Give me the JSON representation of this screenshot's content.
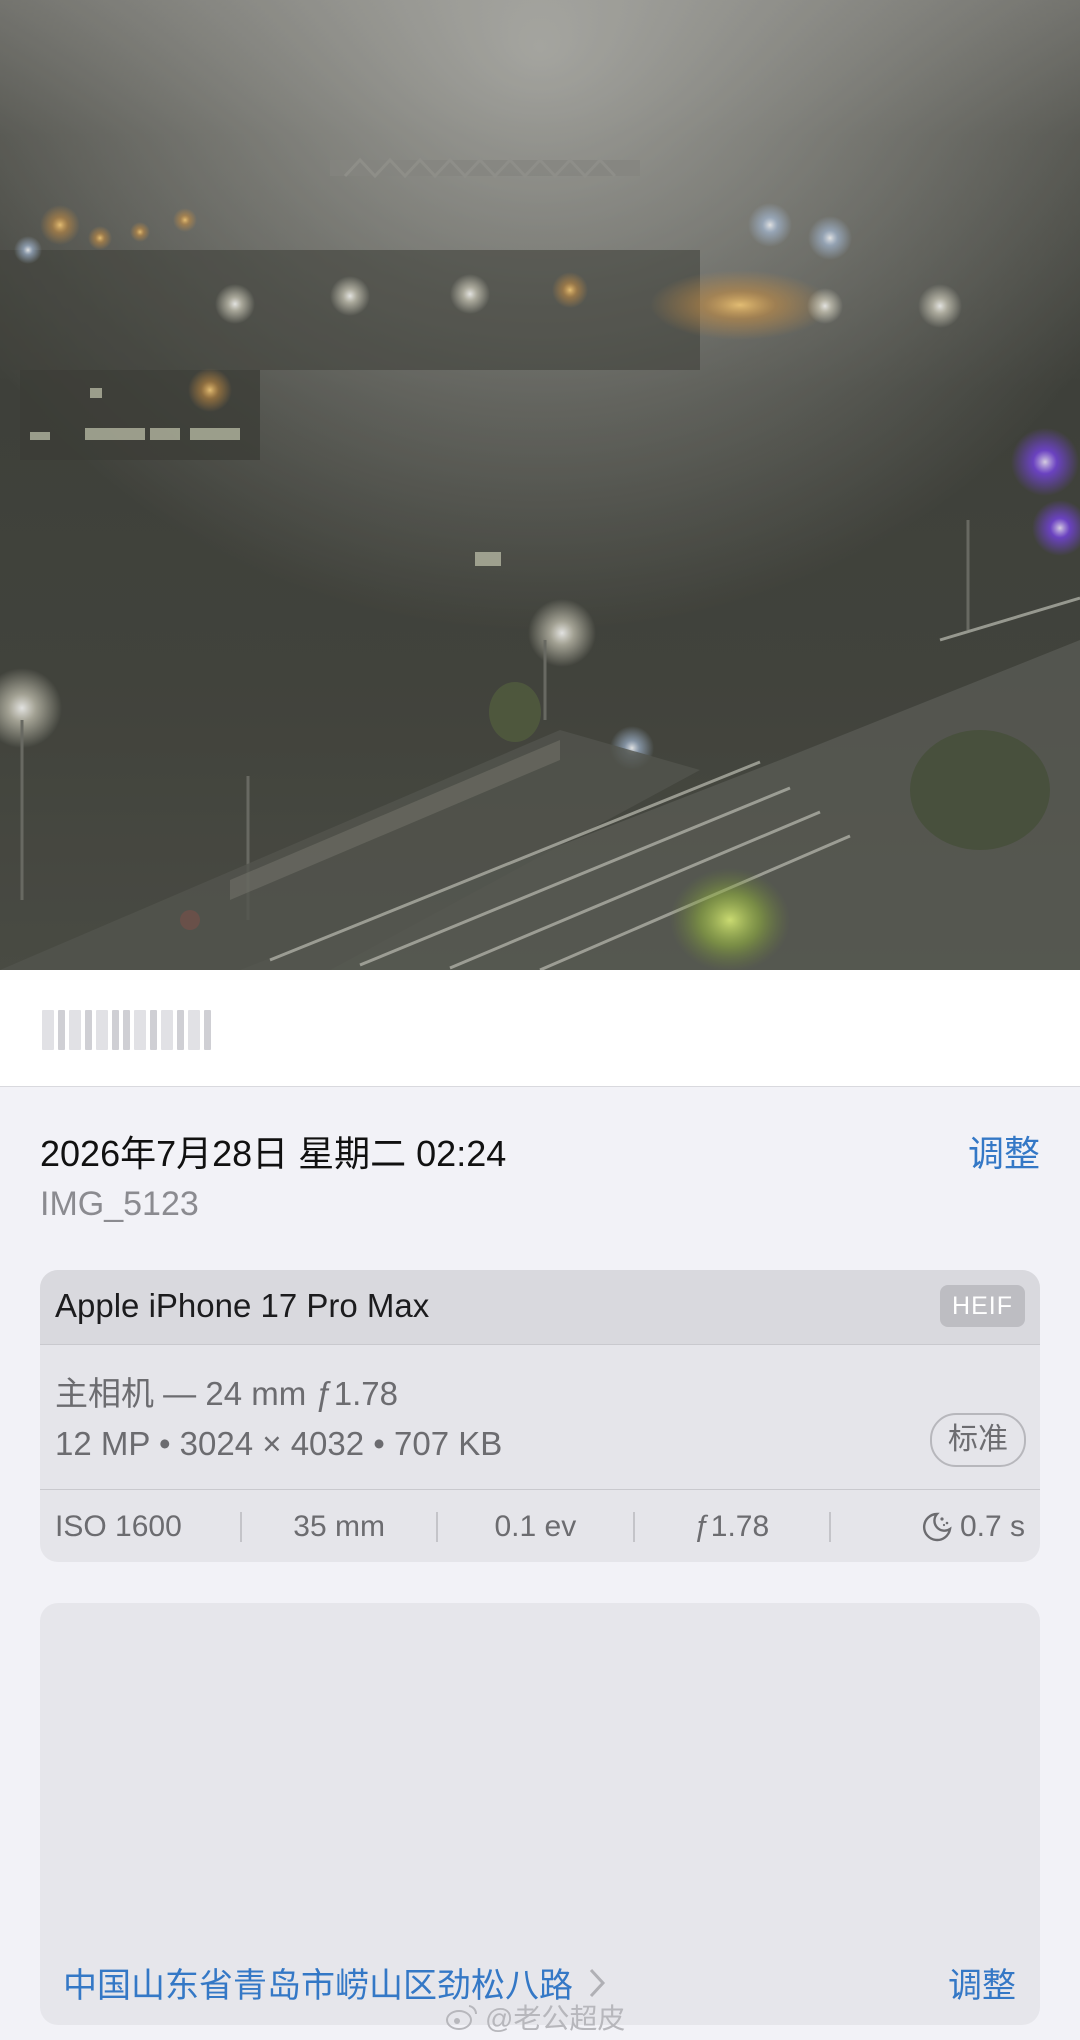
{
  "photo": {
    "description_icon": "night-fog-city-photo"
  },
  "info": {
    "datetime": "2026年7月28日 星期二 02:24",
    "adjust_label": "调整",
    "filename": "IMG_5123"
  },
  "camera_card": {
    "device": "Apple iPhone 17 Pro Max",
    "format_badge": "HEIF",
    "lens": "主相机 — 24 mm ƒ1.78",
    "specs": "12 MP • 3024 × 4032 • 707 KB",
    "style_badge": "标准",
    "exif": {
      "iso": "ISO 1600",
      "focal": "35 mm",
      "ev": "0.1 ev",
      "aperture": "ƒ1.78",
      "shutter": "0.7 s"
    }
  },
  "map": {
    "location": "中国山东省青岛市崂山区劲松八路",
    "adjust_label": "调整"
  },
  "watermark": "@老公超皮",
  "colors": {
    "accent": "#3478c6",
    "panel_bg": "#f2f2f7",
    "card_bg": "#e5e5ea"
  }
}
